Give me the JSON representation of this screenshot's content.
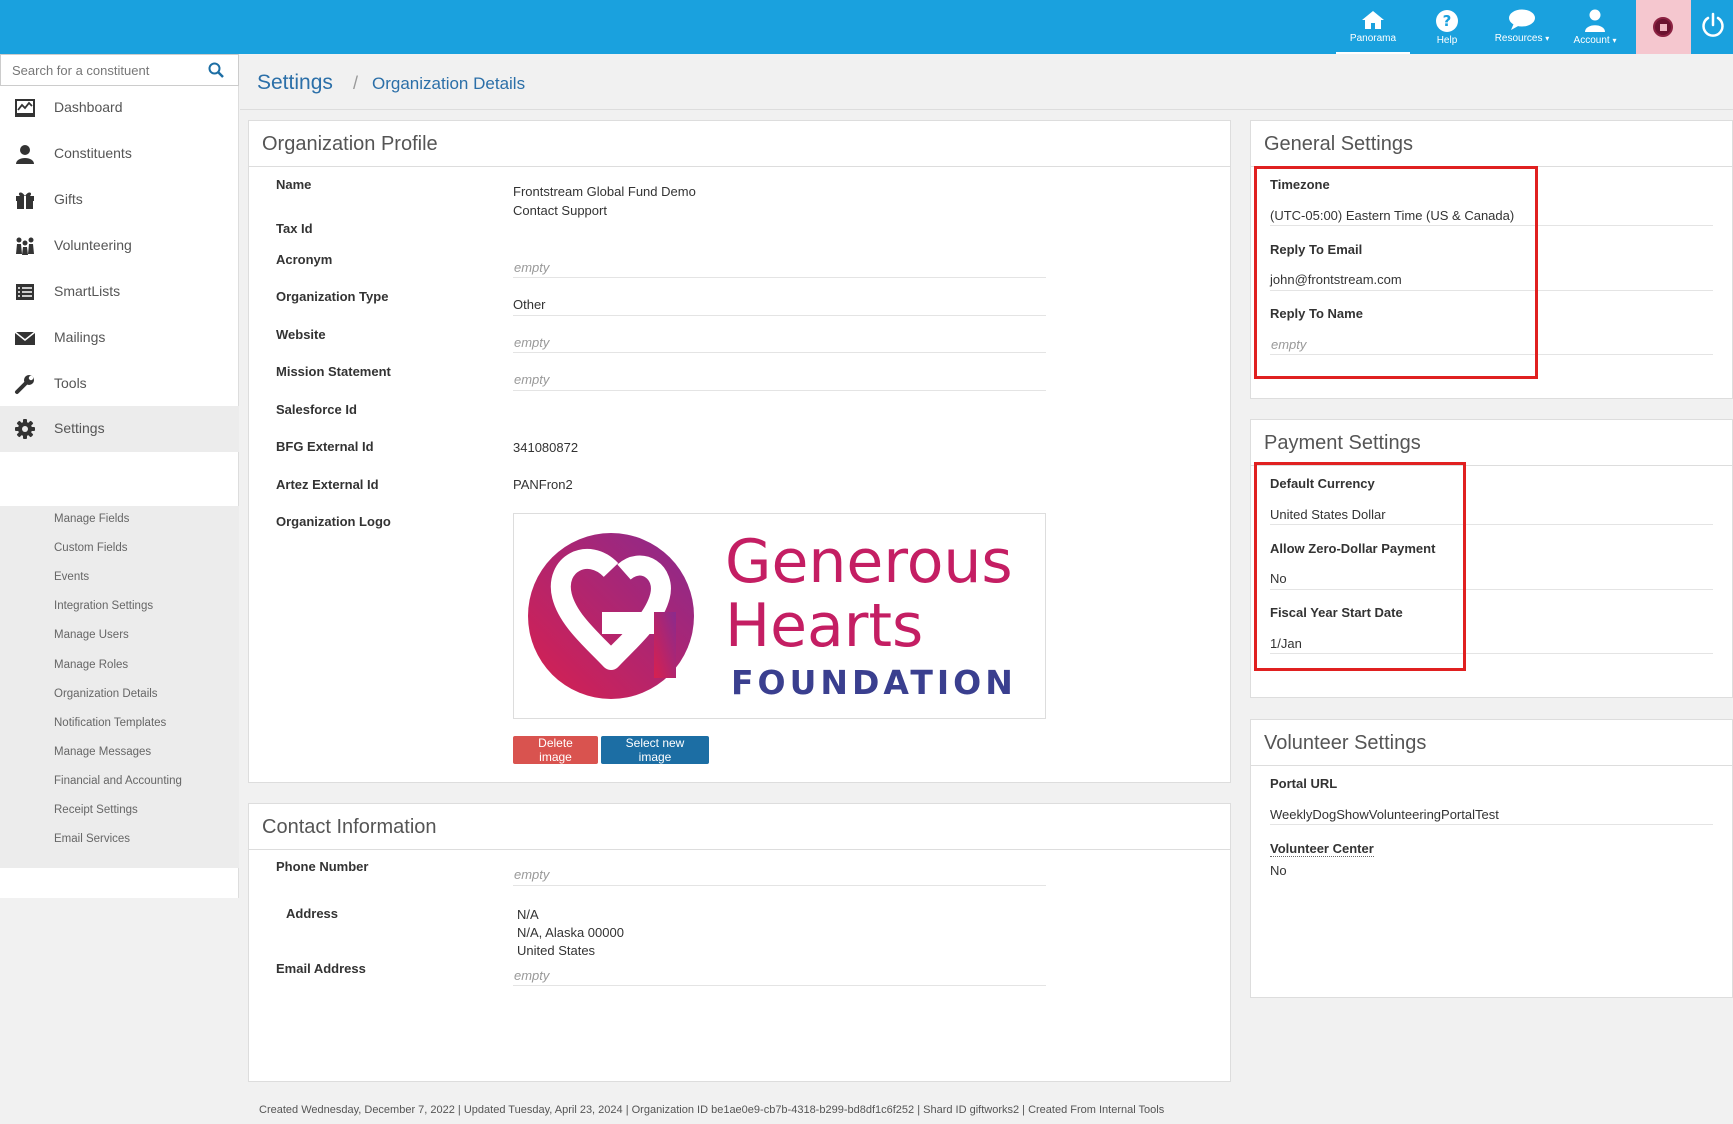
{
  "topnav": {
    "items": [
      {
        "label": "Panorama"
      },
      {
        "label": "Help"
      },
      {
        "label": "Resources"
      },
      {
        "label": "Account"
      }
    ]
  },
  "search": {
    "placeholder": "Search for a constituent"
  },
  "sidebar": {
    "items": [
      {
        "label": "Dashboard",
        "icon": "dashboard-icon"
      },
      {
        "label": "Constituents",
        "icon": "person-icon"
      },
      {
        "label": "Gifts",
        "icon": "gift-icon"
      },
      {
        "label": "Volunteering",
        "icon": "volunteers-icon"
      },
      {
        "label": "SmartLists",
        "icon": "list-icon"
      },
      {
        "label": "Mailings",
        "icon": "envelope-icon"
      },
      {
        "label": "Tools",
        "icon": "wrench-icon"
      },
      {
        "label": "Settings",
        "icon": "gear-icon"
      }
    ],
    "settings_subitems": [
      "Manage Fields",
      "Custom Fields",
      "Events",
      "Integration Settings",
      "Manage Users",
      "Manage Roles",
      "Organization Details",
      "Notification Templates",
      "Manage Messages",
      "Financial and Accounting",
      "Receipt Settings",
      "Email Services"
    ]
  },
  "breadcrumb": {
    "root": "Settings",
    "separator": "/",
    "current": "Organization Details"
  },
  "org_profile": {
    "title": "Organization Profile",
    "name_label": "Name",
    "name_value_1": "Frontstream Global Fund Demo",
    "name_value_2": "Contact Support",
    "tax_id_label": "Tax Id",
    "acronym_label": "Acronym",
    "acronym_value": "empty",
    "org_type_label": "Organization Type",
    "org_type_value": "Other",
    "website_label": "Website",
    "website_value": "empty",
    "mission_label": "Mission Statement",
    "mission_value": "empty",
    "salesforce_label": "Salesforce Id",
    "bfg_label": "BFG External Id",
    "bfg_value": "341080872",
    "artez_label": "Artez External Id",
    "artez_value": "PANFron2",
    "logo_label": "Organization Logo",
    "logo": {
      "line1": "Generous",
      "line2": "Hearts",
      "line3": "FOUNDATION"
    },
    "delete_button": "Delete image",
    "select_button": "Select new image"
  },
  "contact": {
    "title": "Contact Information",
    "phone_label": "Phone Number",
    "phone_value": "empty",
    "address_label": "Address",
    "address_line1": "N/A",
    "address_line2": "N/A, Alaska 00000",
    "address_line3": "United States",
    "email_label": "Email Address",
    "email_value": "empty"
  },
  "general_settings": {
    "title": "General Settings",
    "timezone_label": "Timezone",
    "timezone_value": "(UTC-05:00) Eastern Time (US & Canada)",
    "reply_email_label": "Reply To Email",
    "reply_email_value": "john@frontstream.com",
    "reply_name_label": "Reply To Name",
    "reply_name_value": "empty"
  },
  "payment_settings": {
    "title": "Payment Settings",
    "currency_label": "Default Currency",
    "currency_value": "United States Dollar",
    "zero_label": "Allow Zero-Dollar Payment",
    "zero_value": "No",
    "fiscal_label": "Fiscal Year Start Date",
    "fiscal_value": "1/Jan"
  },
  "volunteer_settings": {
    "title": "Volunteer Settings",
    "portal_label": "Portal URL",
    "portal_value": "WeeklyDogShowVolunteeringPortalTest",
    "center_label": "Volunteer Center",
    "center_value": "No"
  },
  "footer": {
    "text": "Created Wednesday, December 7, 2022 | Updated Tuesday, April 23, 2024 | Organization ID be1ae0e9-cb7b-4318-b299-bd8df1c6f252 | Shard ID giftworks2 | Created From Internal Tools"
  },
  "colors": {
    "topbar": "#1aa1de",
    "link_blue": "#2b6fa8",
    "highlight_red": "#e02020",
    "delete_red": "#d9534f",
    "select_blue": "#1c6ea4",
    "logo_magenta": "#c41e63",
    "logo_navy": "#3a3f8f"
  }
}
